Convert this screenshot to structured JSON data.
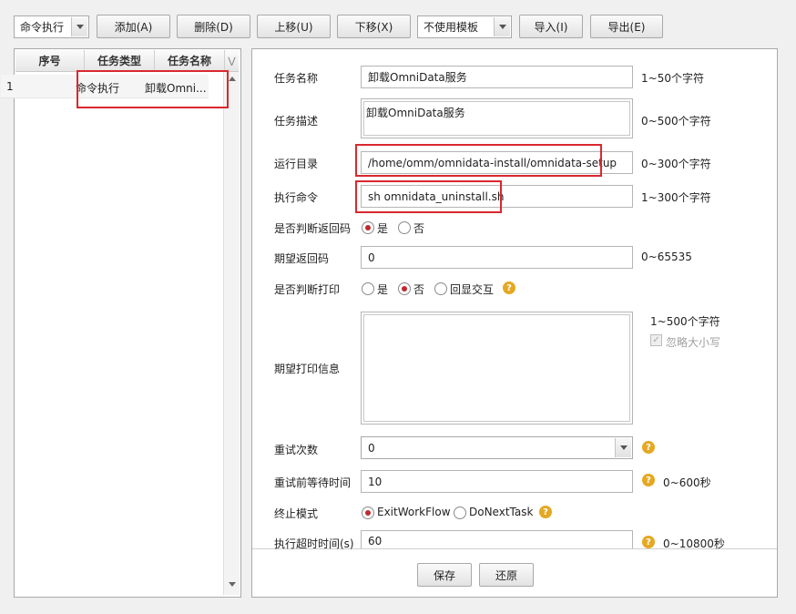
{
  "toolbar": {
    "mode_select": "命令执行",
    "add_label": "添加(A)",
    "delete_label": "删除(D)",
    "move_up_label": "上移(U)",
    "move_down_label": "下移(X)",
    "template_select": "不使用模板",
    "import_label": "导入(I)",
    "export_label": "导出(E)"
  },
  "task_list": {
    "columns": [
      "序号",
      "任务类型",
      "任务名称"
    ],
    "rows": [
      {
        "index": "1",
        "type": "命令执行",
        "name": "卸载Omni..."
      }
    ]
  },
  "form": {
    "task_name": {
      "label": "任务名称",
      "value": "卸载OmniData服务",
      "hint": "1~50个字符"
    },
    "task_desc": {
      "label": "任务描述",
      "value": "卸载OmniData服务",
      "hint": "0~500个字符"
    },
    "run_dir": {
      "label": "运行目录",
      "value": "/home/omm/omnidata-install/omnidata-setup",
      "hint": "0~300个字符"
    },
    "command": {
      "label": "执行命令",
      "value": "sh omnidata_uninstall.sh",
      "hint": "1~300个字符"
    },
    "check_return": {
      "label": "是否判断返回码",
      "options": [
        "是",
        "否"
      ],
      "selected": "是"
    },
    "expected_return": {
      "label": "期望返回码",
      "value": "0",
      "hint": "0~65535"
    },
    "check_print": {
      "label": "是否判断打印",
      "options": [
        "是",
        "否",
        "回显交互"
      ],
      "selected": "否"
    },
    "expected_print": {
      "label": "期望打印信息",
      "value": "",
      "hint": "1~500个字符",
      "ignore_case": "忽略大小写"
    },
    "retry_count": {
      "label": "重试次数",
      "value": "0"
    },
    "retry_wait": {
      "label": "重试前等待时间",
      "value": "10",
      "hint": "0~600秒"
    },
    "stop_mode": {
      "label": "终止模式",
      "options": [
        "ExitWorkFlow",
        "DoNextTask"
      ],
      "selected": "ExitWorkFlow"
    },
    "timeout": {
      "label": "执行超时时间(s)",
      "value": "60",
      "hint": "0~10800秒"
    }
  },
  "footer": {
    "save_label": "保存",
    "restore_label": "还原"
  },
  "icons": {
    "help": "help-icon",
    "dropdown": "chevron-down-icon"
  },
  "colors": {
    "highlight": "#d9282f",
    "radio_selected": "#c0282f",
    "help": "#e5a823"
  }
}
